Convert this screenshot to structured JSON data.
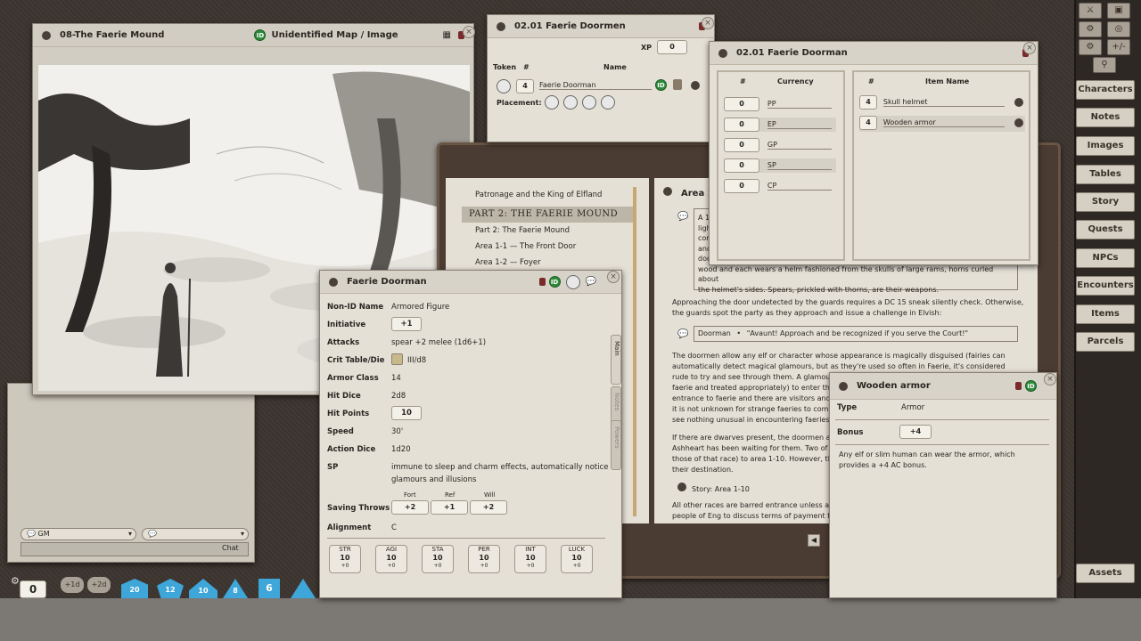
{
  "map_window": {
    "title": "08-The Faerie Mound",
    "id_label": "ID",
    "subtitle": "Unidentified Map / Image"
  },
  "chat": {
    "identity": "GM",
    "target": "",
    "button": "Chat"
  },
  "dicebar": {
    "counter": "0",
    "mod1": "+1d",
    "mod2": "+2d",
    "dice": [
      "20",
      "12",
      "10",
      "8",
      "6",
      "4"
    ]
  },
  "npc_group": {
    "title": "02.01 Faerie Doormen",
    "xp_label": "XP",
    "xp_value": "0",
    "col_token": "Token",
    "col_num": "#",
    "col_name": "Name",
    "row_count": "4",
    "row_name": "Faerie Doorman",
    "placement_label": "Placement:"
  },
  "parcel": {
    "title": "02.01 Faerie Doorman",
    "currency_header_num": "#",
    "currency_header": "Currency",
    "currencies": [
      {
        "count": "0",
        "name": "PP"
      },
      {
        "count": "0",
        "name": "EP"
      },
      {
        "count": "0",
        "name": "GP"
      },
      {
        "count": "0",
        "name": "SP"
      },
      {
        "count": "0",
        "name": "CP"
      }
    ],
    "items_header_num": "#",
    "items_header": "Item Name",
    "items": [
      {
        "count": "4",
        "name": "Skull helmet"
      },
      {
        "count": "4",
        "name": "Wooden armor"
      }
    ]
  },
  "story_index": {
    "items": [
      "Patronage and the King of Elfland",
      "PART 2: THE FAERIE MOUND",
      "Part 2: The Faerie Mound",
      "Area 1-1 — The Front Door",
      "Area 1-2 — Foyer"
    ]
  },
  "story": {
    "title": "Area 1",
    "box1_lines": [
      "A 10",
      "ligh",
      "cor",
      "and",
      "doo"
    ],
    "box1_tail1": "wood and each wears a helm fashioned from the skulls of large rams, horns curled about",
    "box1_tail2": "the helmet's sides. Spears, prickled with thorns, are their weapons.",
    "para1": "Approaching the door undetected by the guards requires a DC 15 sneak silently check. Otherwise, the guards spot the party as they approach and issue a challenge in Elvish:",
    "speaker": "Doorman",
    "bullet": "•",
    "quote": "\"Avaunt! Approach and be recognized if you serve the Court!\"",
    "para2_lines": [
      "The doormen allow any elf or character whose appearance is magically disguised (fairies can",
      "automatically detect magical glamours, but as they're used so often in Faerie, it's considered",
      "rude to try and see through them. A glamou",
      "faerie and treated appropriately) to enter th",
      "entrance to faerie and there are visitors and",
      "it is not unknown for strange faeries to come",
      "see nothing unusual in encountering faeries"
    ],
    "para3_lines": [
      "If there are dwarves present, the doormen a",
      "Ashheart has been waiting for them. Two of",
      "those of that race) to area 1-10. However, th",
      "their destination."
    ],
    "story_link": "Story: Area 1-10",
    "para4_lines": [
      "All other races are barred entrance unless a",
      "people of Eng to discuss terms of payment fo"
    ]
  },
  "npc": {
    "title": "Faerie Doorman",
    "id_label": "ID",
    "rows": [
      {
        "label": "Non-ID Name",
        "value": "Armored Figure"
      },
      {
        "label": "Initiative",
        "value": "+1"
      },
      {
        "label": "Attacks",
        "value": "spear +2 melee (1d6+1)"
      },
      {
        "label": "Crit Table/Die",
        "value": "III/d8"
      },
      {
        "label": "Armor Class",
        "value": "14"
      },
      {
        "label": "Hit Dice",
        "value": "2d8"
      },
      {
        "label": "Hit Points",
        "value": "10"
      },
      {
        "label": "Speed",
        "value": "30'"
      },
      {
        "label": "Action Dice",
        "value": "1d20"
      },
      {
        "label": "SP",
        "value": "immune to sleep and charm effects, automatically notice"
      },
      {
        "label": "",
        "value": "glamours and illusions"
      }
    ],
    "saving_label": "Saving Throws",
    "saves": [
      {
        "name": "Fort",
        "value": "+2"
      },
      {
        "name": "Ref",
        "value": "+1"
      },
      {
        "name": "Will",
        "value": "+2"
      }
    ],
    "alignment_label": "Alignment",
    "alignment": "C",
    "stats": [
      {
        "name": "STR",
        "value": "10",
        "mod": "+0"
      },
      {
        "name": "AGI",
        "value": "10",
        "mod": "+0"
      },
      {
        "name": "STA",
        "value": "10",
        "mod": "+0"
      },
      {
        "name": "PER",
        "value": "10",
        "mod": "+0"
      },
      {
        "name": "INT",
        "value": "10",
        "mod": "+0"
      },
      {
        "name": "LUCK",
        "value": "10",
        "mod": "+0"
      }
    ],
    "tabs": [
      "Main",
      "Notes",
      "Powers"
    ]
  },
  "item": {
    "title": "Wooden armor",
    "id_label": "ID",
    "type_label": "Type",
    "type_value": "Armor",
    "bonus_label": "Bonus",
    "bonus_value": "+4",
    "desc1": "Any elf or slim human can wear the armor, which",
    "desc2": "provides a +4 AC bonus."
  },
  "sidebar": {
    "tools": [
      "⚔",
      "▣",
      "⚙",
      "◎",
      "⚙",
      "+/-"
    ],
    "buttons": [
      "Characters",
      "Notes",
      "Images",
      "Tables",
      "Story",
      "Quests",
      "NPCs",
      "Encounters",
      "Items",
      "Parcels"
    ],
    "assets": "Assets"
  },
  "colors": {
    "accent_green": "#2e8b3a",
    "die_blue": "#3ea6d8",
    "parchment": "#e4e0d6"
  }
}
